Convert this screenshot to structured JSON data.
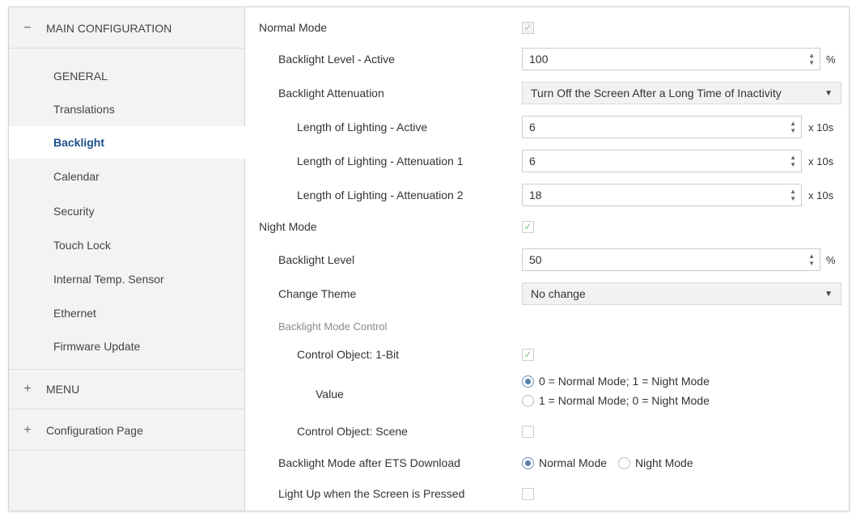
{
  "sidebar": {
    "main_configuration": {
      "sign": "−",
      "label": "MAIN CONFIGURATION"
    },
    "items": [
      {
        "label": "GENERAL"
      },
      {
        "label": "Translations"
      },
      {
        "label": "Backlight"
      },
      {
        "label": "Calendar"
      },
      {
        "label": "Security"
      },
      {
        "label": "Touch Lock"
      },
      {
        "label": "Internal Temp. Sensor"
      },
      {
        "label": "Ethernet"
      },
      {
        "label": "Firmware Update"
      }
    ],
    "active_item": "Backlight",
    "menu": {
      "sign": "+",
      "label": "MENU"
    },
    "configuration_page": {
      "sign": "+",
      "label": "Configuration Page"
    }
  },
  "content": {
    "normal_mode": {
      "label": "Normal Mode",
      "checked": true,
      "enabled": false
    },
    "backlight_level_active": {
      "label": "Backlight Level - Active",
      "value": "100",
      "unit": "%"
    },
    "backlight_attenuation": {
      "label": "Backlight Attenuation",
      "value": "Turn Off the Screen After a Long Time of Inactivity"
    },
    "length_active": {
      "label": "Length of Lighting - Active",
      "value": "6",
      "unit": "x 10s"
    },
    "length_att1": {
      "label": "Length of Lighting - Attenuation 1",
      "value": "6",
      "unit": "x 10s"
    },
    "length_att2": {
      "label": "Length of Lighting - Attenuation 2",
      "value": "18",
      "unit": "x 10s"
    },
    "night_mode": {
      "label": "Night Mode",
      "checked": true
    },
    "backlight_level": {
      "label": "Backlight Level",
      "value": "50",
      "unit": "%"
    },
    "change_theme": {
      "label": "Change Theme",
      "value": "No change"
    },
    "backlight_mode_control": {
      "label": "Backlight Mode Control"
    },
    "control_object_1bit": {
      "label": "Control Object: 1-Bit",
      "checked": true
    },
    "value": {
      "label": "Value",
      "options": [
        "0 = Normal Mode; 1 = Night Mode",
        "1 = Normal Mode; 0 = Night Mode"
      ],
      "selected": 0
    },
    "control_object_scene": {
      "label": "Control Object: Scene",
      "checked": false
    },
    "mode_after_download": {
      "label": "Backlight Mode after ETS Download",
      "options": [
        "Normal Mode",
        "Night Mode"
      ],
      "selected": 0
    },
    "light_up_pressed": {
      "label": "Light Up when the Screen is Pressed",
      "checked": false
    }
  },
  "icons": {
    "check": "✓",
    "spin_up": "▲",
    "spin_down": "▼",
    "caret": "▼"
  },
  "colors": {
    "active_nav_text": "#1c4f8c",
    "check_green": "#7fbf7f",
    "radio_selected": "#5a7fae",
    "sidebar_bg": "#f3f3f3"
  }
}
